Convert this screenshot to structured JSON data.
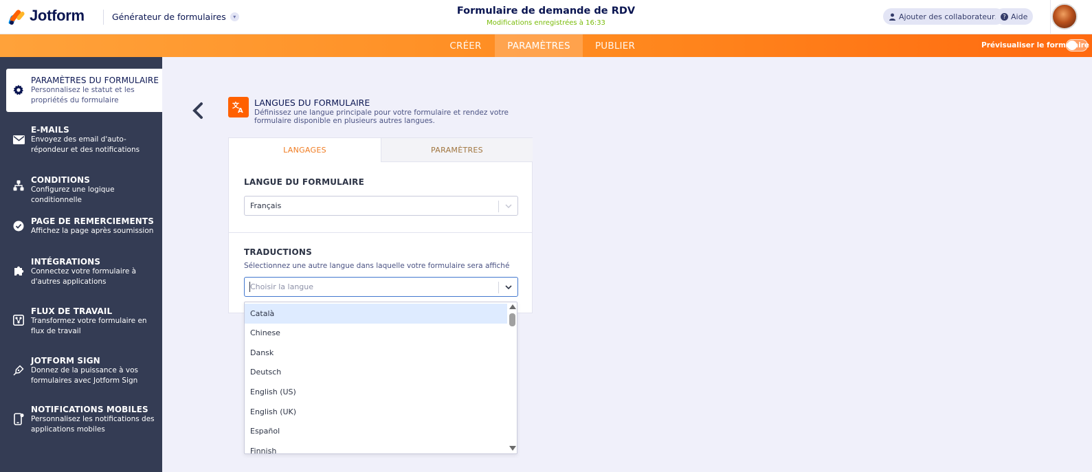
{
  "header": {
    "brand": "Jotform",
    "builder_label": "Générateur de formulaires",
    "form_title": "Formulaire de demande de RDV",
    "saved_status": "Modifications enregistrées à 16:33",
    "add_collaborators": "Ajouter des collaborateurs",
    "help": "Aide"
  },
  "nav": {
    "tabs": [
      "CRÉER",
      "PARAMÈTRES",
      "PUBLIER"
    ],
    "active_tab": "PARAMÈTRES",
    "preview_label": "Prévisualiser le formulaire",
    "preview_enabled": false
  },
  "sidebar": {
    "items": [
      {
        "icon": "gear-icon",
        "title": "PARAMÈTRES DU FORMULAIRE",
        "desc": "Personnalisez le statut et les propriétés du formulaire",
        "active": true
      },
      {
        "icon": "envelope-icon",
        "title": "E-MAILS",
        "desc": "Envoyez des email d'auto-répondeur et des notifications"
      },
      {
        "icon": "sitemap-icon",
        "title": "CONDITIONS",
        "desc": "Configurez une logique conditionnelle"
      },
      {
        "icon": "check-circle-icon",
        "title": "PAGE DE REMERCIEMENTS",
        "desc": "Affichez la page après soumission"
      },
      {
        "icon": "puzzle-icon",
        "title": "INTÉGRATIONS",
        "desc": "Connectez votre formulaire à d'autres applications"
      },
      {
        "icon": "workflow-icon",
        "title": "FLUX DE TRAVAIL",
        "desc": "Transformez votre formulaire en flux de travail"
      },
      {
        "icon": "pen-nib-icon",
        "title": "JOTFORM SIGN",
        "desc": "Donnez de la puissance à vos formulaires avec Jotform Sign"
      },
      {
        "icon": "mobile-notification-icon",
        "title": "NOTIFICATIONS MOBILES",
        "desc": "Personnalisez les notifications des applications mobiles"
      }
    ]
  },
  "section": {
    "title": "LANGUES DU FORMULAIRE",
    "description": "Définissez une langue principale pour votre formulaire et rendez votre formulaire disponible en plusieurs autres langues."
  },
  "card": {
    "tabs": [
      "LANGAGES",
      "PARAMÈTRES"
    ],
    "active_tab": "LANGAGES",
    "form_language_label": "LANGUE DU FORMULAIRE",
    "form_language_value": "Français",
    "translations_label": "TRADUCTIONS",
    "translations_desc": "Sélectionnez une autre langue dans laquelle votre formulaire sera affiché",
    "translations_placeholder": "Choisir la langue"
  },
  "dropdown": {
    "options": [
      "Català",
      "Chinese",
      "Dansk",
      "Deutsch",
      "English (US)",
      "English (UK)",
      "Español",
      "Finnish"
    ],
    "highlighted": "Català"
  },
  "colors": {
    "accent_orange": "#ff6100",
    "nav_gradient_start": "#ffa23a",
    "nav_gradient_end": "#ff6a10",
    "sidebar_bg": "#343c54",
    "saved_green": "#78bb07",
    "focus_blue": "#4277ce"
  }
}
